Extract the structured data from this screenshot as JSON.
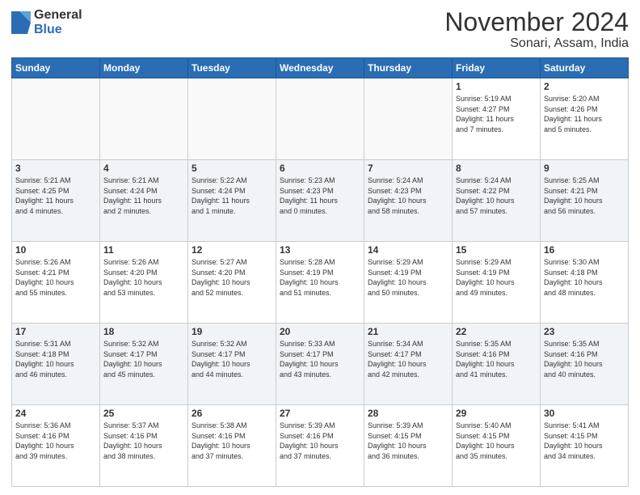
{
  "header": {
    "logo_general": "General",
    "logo_blue": "Blue",
    "month": "November 2024",
    "location": "Sonari, Assam, India"
  },
  "days_of_week": [
    "Sunday",
    "Monday",
    "Tuesday",
    "Wednesday",
    "Thursday",
    "Friday",
    "Saturday"
  ],
  "weeks": [
    {
      "alt": false,
      "days": [
        {
          "num": "",
          "info": ""
        },
        {
          "num": "",
          "info": ""
        },
        {
          "num": "",
          "info": ""
        },
        {
          "num": "",
          "info": ""
        },
        {
          "num": "",
          "info": ""
        },
        {
          "num": "1",
          "info": "Sunrise: 5:19 AM\nSunset: 4:27 PM\nDaylight: 11 hours\nand 7 minutes."
        },
        {
          "num": "2",
          "info": "Sunrise: 5:20 AM\nSunset: 4:26 PM\nDaylight: 11 hours\nand 5 minutes."
        }
      ]
    },
    {
      "alt": true,
      "days": [
        {
          "num": "3",
          "info": "Sunrise: 5:21 AM\nSunset: 4:25 PM\nDaylight: 11 hours\nand 4 minutes."
        },
        {
          "num": "4",
          "info": "Sunrise: 5:21 AM\nSunset: 4:24 PM\nDaylight: 11 hours\nand 2 minutes."
        },
        {
          "num": "5",
          "info": "Sunrise: 5:22 AM\nSunset: 4:24 PM\nDaylight: 11 hours\nand 1 minute."
        },
        {
          "num": "6",
          "info": "Sunrise: 5:23 AM\nSunset: 4:23 PM\nDaylight: 11 hours\nand 0 minutes."
        },
        {
          "num": "7",
          "info": "Sunrise: 5:24 AM\nSunset: 4:23 PM\nDaylight: 10 hours\nand 58 minutes."
        },
        {
          "num": "8",
          "info": "Sunrise: 5:24 AM\nSunset: 4:22 PM\nDaylight: 10 hours\nand 57 minutes."
        },
        {
          "num": "9",
          "info": "Sunrise: 5:25 AM\nSunset: 4:21 PM\nDaylight: 10 hours\nand 56 minutes."
        }
      ]
    },
    {
      "alt": false,
      "days": [
        {
          "num": "10",
          "info": "Sunrise: 5:26 AM\nSunset: 4:21 PM\nDaylight: 10 hours\nand 55 minutes."
        },
        {
          "num": "11",
          "info": "Sunrise: 5:26 AM\nSunset: 4:20 PM\nDaylight: 10 hours\nand 53 minutes."
        },
        {
          "num": "12",
          "info": "Sunrise: 5:27 AM\nSunset: 4:20 PM\nDaylight: 10 hours\nand 52 minutes."
        },
        {
          "num": "13",
          "info": "Sunrise: 5:28 AM\nSunset: 4:19 PM\nDaylight: 10 hours\nand 51 minutes."
        },
        {
          "num": "14",
          "info": "Sunrise: 5:29 AM\nSunset: 4:19 PM\nDaylight: 10 hours\nand 50 minutes."
        },
        {
          "num": "15",
          "info": "Sunrise: 5:29 AM\nSunset: 4:19 PM\nDaylight: 10 hours\nand 49 minutes."
        },
        {
          "num": "16",
          "info": "Sunrise: 5:30 AM\nSunset: 4:18 PM\nDaylight: 10 hours\nand 48 minutes."
        }
      ]
    },
    {
      "alt": true,
      "days": [
        {
          "num": "17",
          "info": "Sunrise: 5:31 AM\nSunset: 4:18 PM\nDaylight: 10 hours\nand 46 minutes."
        },
        {
          "num": "18",
          "info": "Sunrise: 5:32 AM\nSunset: 4:17 PM\nDaylight: 10 hours\nand 45 minutes."
        },
        {
          "num": "19",
          "info": "Sunrise: 5:32 AM\nSunset: 4:17 PM\nDaylight: 10 hours\nand 44 minutes."
        },
        {
          "num": "20",
          "info": "Sunrise: 5:33 AM\nSunset: 4:17 PM\nDaylight: 10 hours\nand 43 minutes."
        },
        {
          "num": "21",
          "info": "Sunrise: 5:34 AM\nSunset: 4:17 PM\nDaylight: 10 hours\nand 42 minutes."
        },
        {
          "num": "22",
          "info": "Sunrise: 5:35 AM\nSunset: 4:16 PM\nDaylight: 10 hours\nand 41 minutes."
        },
        {
          "num": "23",
          "info": "Sunrise: 5:35 AM\nSunset: 4:16 PM\nDaylight: 10 hours\nand 40 minutes."
        }
      ]
    },
    {
      "alt": false,
      "days": [
        {
          "num": "24",
          "info": "Sunrise: 5:36 AM\nSunset: 4:16 PM\nDaylight: 10 hours\nand 39 minutes."
        },
        {
          "num": "25",
          "info": "Sunrise: 5:37 AM\nSunset: 4:16 PM\nDaylight: 10 hours\nand 38 minutes."
        },
        {
          "num": "26",
          "info": "Sunrise: 5:38 AM\nSunset: 4:16 PM\nDaylight: 10 hours\nand 37 minutes."
        },
        {
          "num": "27",
          "info": "Sunrise: 5:39 AM\nSunset: 4:16 PM\nDaylight: 10 hours\nand 37 minutes."
        },
        {
          "num": "28",
          "info": "Sunrise: 5:39 AM\nSunset: 4:15 PM\nDaylight: 10 hours\nand 36 minutes."
        },
        {
          "num": "29",
          "info": "Sunrise: 5:40 AM\nSunset: 4:15 PM\nDaylight: 10 hours\nand 35 minutes."
        },
        {
          "num": "30",
          "info": "Sunrise: 5:41 AM\nSunset: 4:15 PM\nDaylight: 10 hours\nand 34 minutes."
        }
      ]
    }
  ]
}
